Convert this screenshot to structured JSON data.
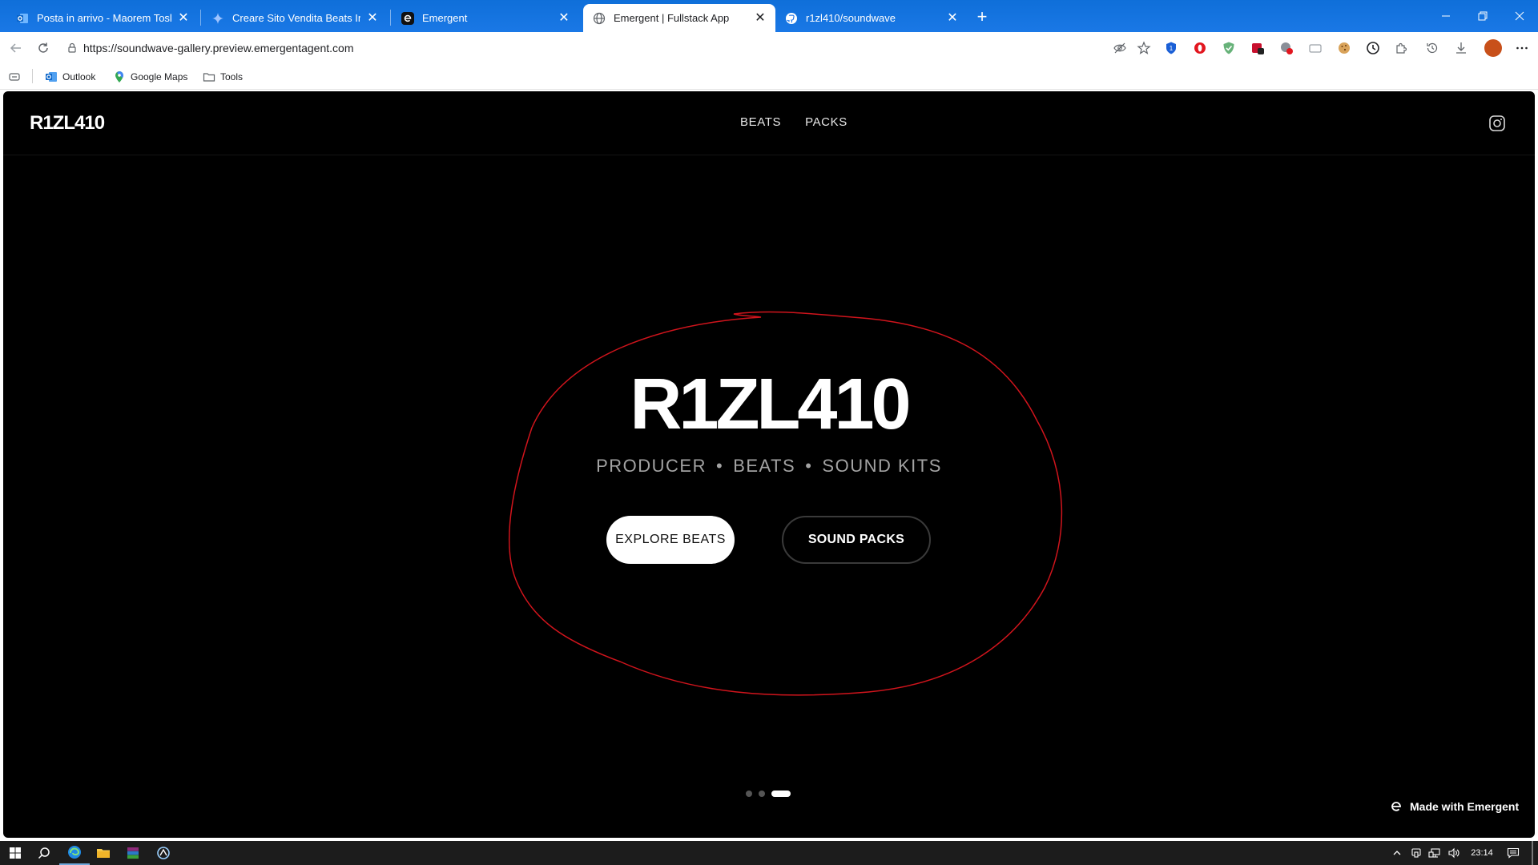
{
  "browser": {
    "tabs": [
      {
        "title": "Posta in arrivo - Maorem Tosku - O",
        "icon": "outlook-icon",
        "active": false
      },
      {
        "title": "Creare Sito Vendita Beats Indipend",
        "icon": "gemini-icon",
        "active": false
      },
      {
        "title": "Emergent",
        "icon": "emergent-icon",
        "active": false
      },
      {
        "title": "Emergent | Fullstack App",
        "icon": "globe-icon",
        "active": true
      },
      {
        "title": "r1zl410/soundwave",
        "icon": "github-icon",
        "active": false
      }
    ],
    "address": {
      "url": "https://soundwave-gallery.preview.emergentagent.com"
    },
    "bookmarks": [
      {
        "label": "Outlook",
        "icon": "outlook-icon"
      },
      {
        "label": "Google Maps",
        "icon": "maps-pin-icon"
      },
      {
        "label": "Tools",
        "icon": "folder-icon"
      }
    ],
    "colors": {
      "tabstrip": "#1a73e8",
      "profile": "#c8501a"
    }
  },
  "site": {
    "logo": "R1ZL410",
    "nav": [
      "BEATS",
      "PACKS"
    ],
    "hero": {
      "title": "R1ZL410",
      "subtitle": [
        "PRODUCER",
        "BEATS",
        "SOUND KITS"
      ],
      "separator": "•",
      "primary_button": "EXPLORE BEATS",
      "secondary_button": "SOUND PACKS"
    },
    "carousel": {
      "count": 3,
      "active_index": 2
    },
    "badge": "Made with Emergent",
    "annotation_color": "#d0141c"
  },
  "taskbar": {
    "clock": "23:14"
  }
}
